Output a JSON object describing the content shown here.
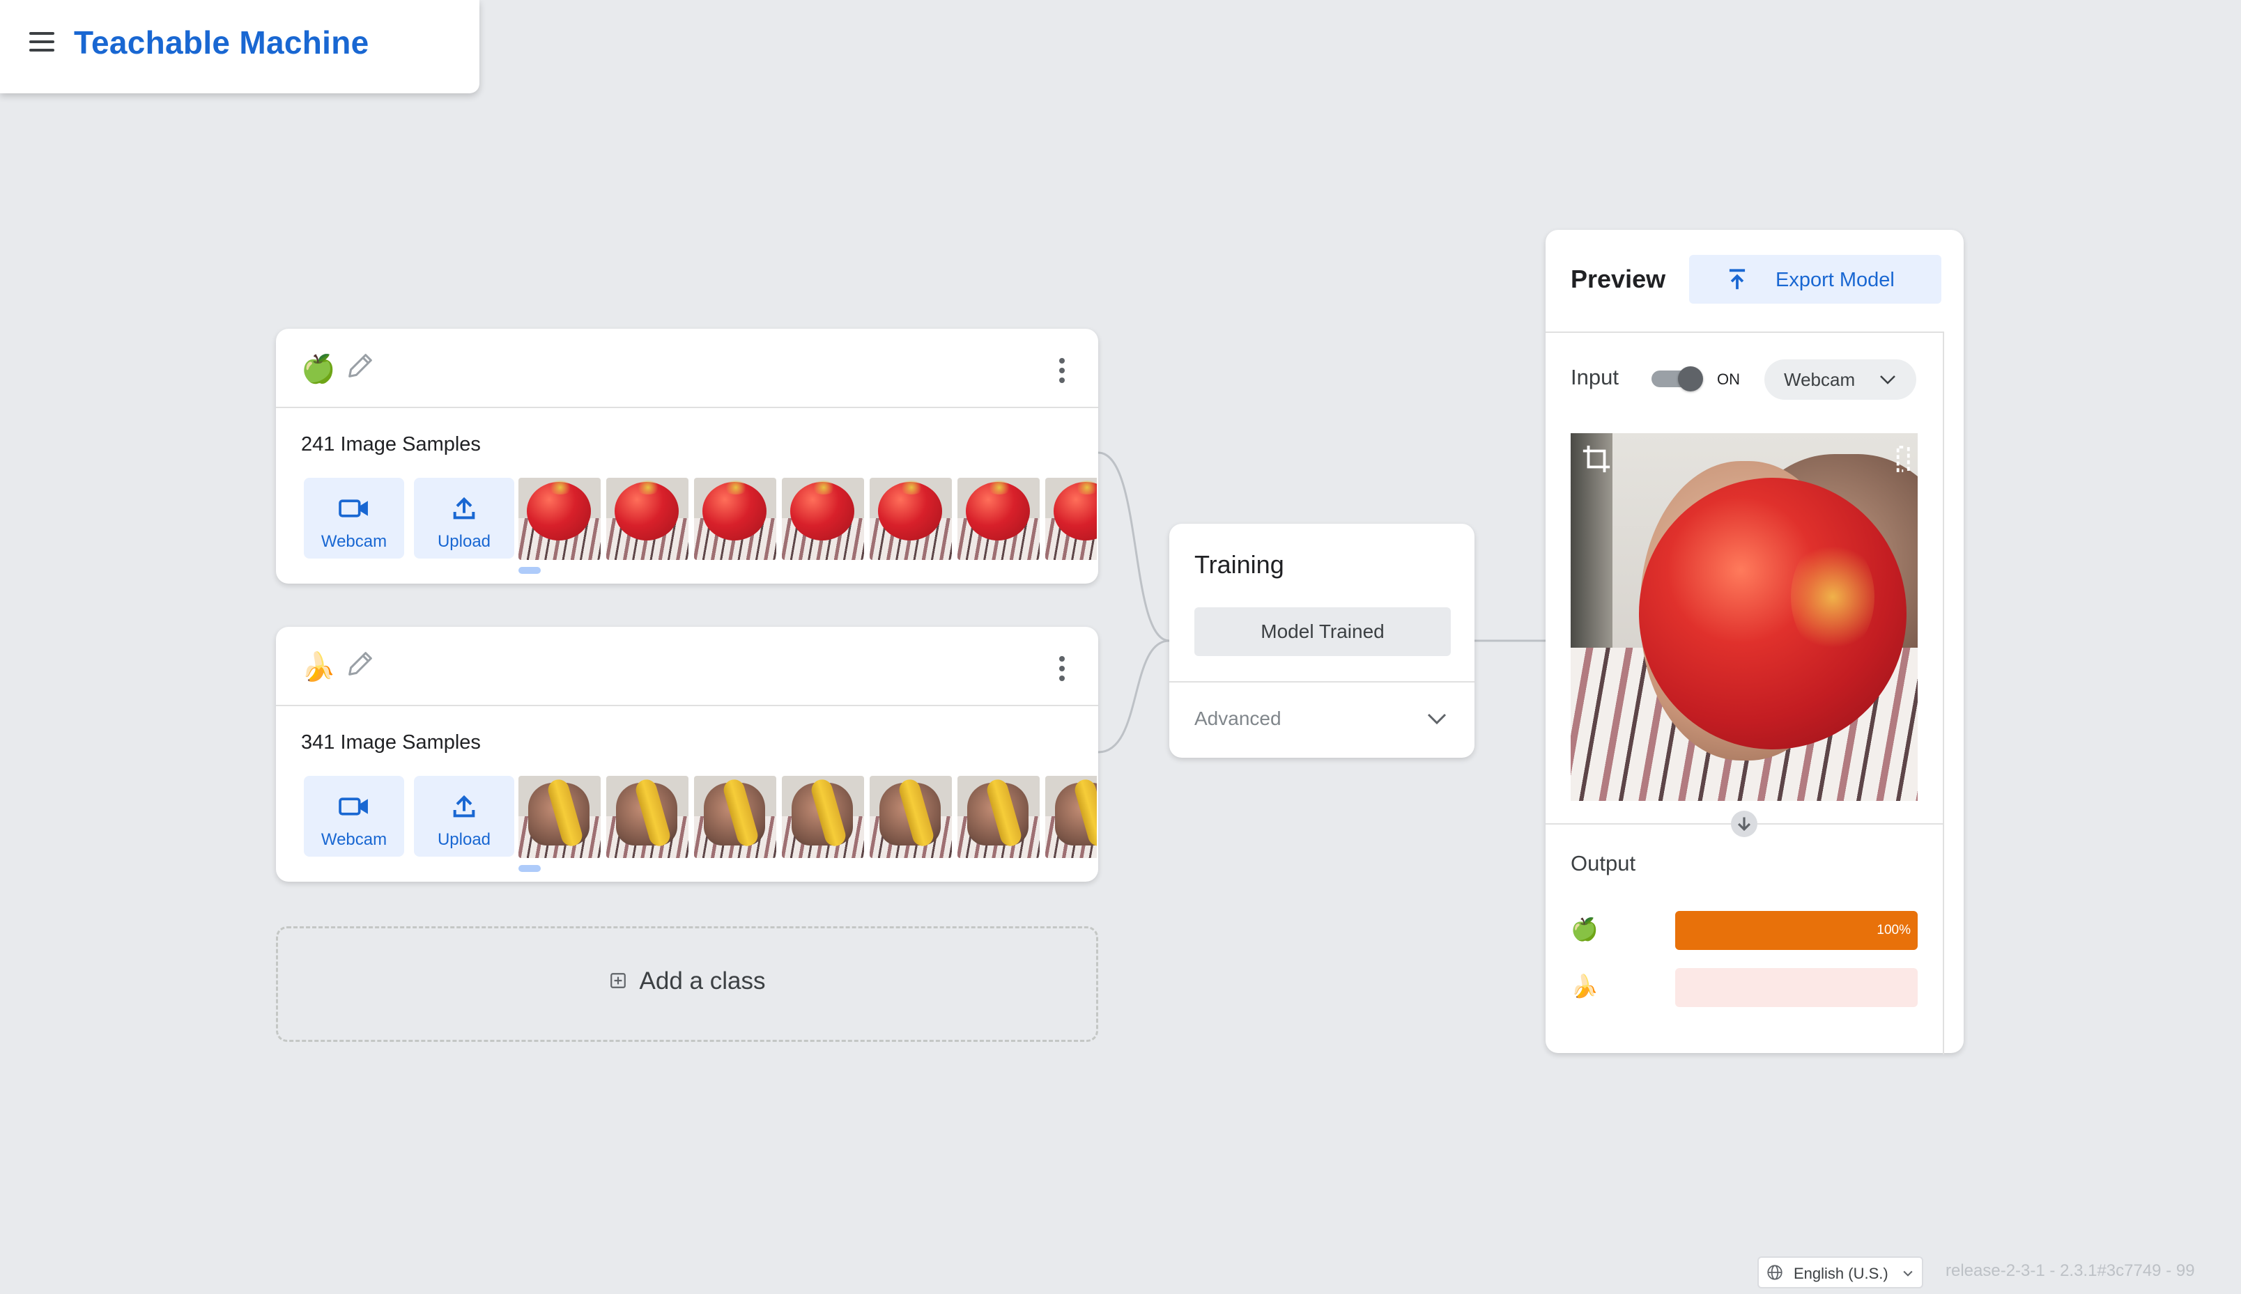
{
  "header": {
    "app_title": "Teachable Machine"
  },
  "classes": [
    {
      "emoji": "🍏",
      "samples_label": "241 Image Samples",
      "webcam_label": "Webcam",
      "upload_label": "Upload",
      "thumbnail_subject": "apple"
    },
    {
      "emoji": "🍌",
      "samples_label": "341 Image Samples",
      "webcam_label": "Webcam",
      "upload_label": "Upload",
      "thumbnail_subject": "banana"
    }
  ],
  "add_class": {
    "label": "Add a class"
  },
  "training": {
    "title": "Training",
    "status_button": "Model Trained",
    "advanced_label": "Advanced"
  },
  "preview": {
    "title": "Preview",
    "export_label": "Export Model",
    "input_label": "Input",
    "toggle_state": "ON",
    "input_source": "Webcam",
    "output_label": "Output",
    "outputs": [
      {
        "emoji": "🍏",
        "percent": 100,
        "percent_label": "100%",
        "color": "#e8710a"
      },
      {
        "emoji": "🍌",
        "percent": 0,
        "percent_label": "",
        "color": "#fce8e6"
      }
    ]
  },
  "footer": {
    "language": "English (U.S.)",
    "release": "release-2-3-1 - 2.3.1#3c7749 - 99"
  },
  "colors": {
    "accent": "#1967d2",
    "button_bg": "#e8f0fe",
    "background": "#e8eaed"
  }
}
